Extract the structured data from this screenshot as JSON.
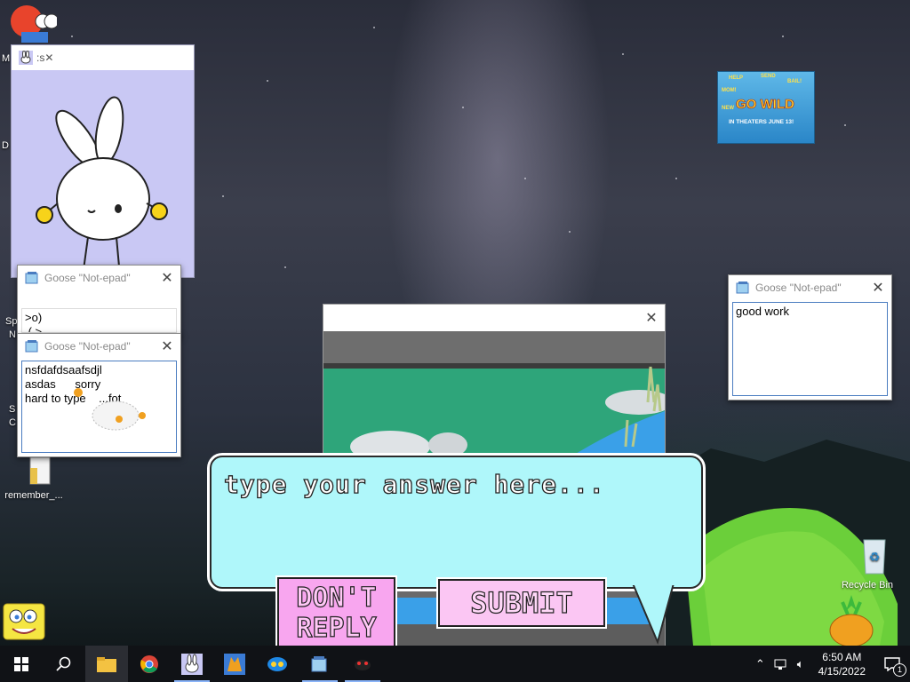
{
  "desktop": {
    "icons": [
      {
        "label": "M"
      },
      {
        "label": "D"
      },
      {
        "label": "Sp"
      },
      {
        "label": "N"
      },
      {
        "label": "S"
      },
      {
        "label": "C"
      },
      {
        "label": "remember_..."
      },
      {
        "label": "Recycle Bin"
      }
    ],
    "poster": {
      "words": [
        "HELP",
        "SEND",
        "MOM!",
        "BAIL!",
        "NEW",
        "GO WILD",
        "IN THEATERS JUNE 13!"
      ]
    }
  },
  "bunny_window": {
    "title": ":s"
  },
  "notepads": [
    {
      "title": "Goose \"Not-epad\"",
      "text": ">o)\n ( >"
    },
    {
      "title": "Goose \"Not-epad\"",
      "text": "nsfdafdsaafsdjl\nasdas      sorry\nhard to type    ...fot"
    },
    {
      "title": "Goose \"Not-epad\"",
      "text": "good work"
    }
  ],
  "dialog": {
    "prompt": "type your answer here...",
    "dont_reply": "DON'T\nREPLY",
    "submit": "SUBMIT"
  },
  "taskbar": {
    "time": "6:50 AM",
    "date": "4/15/2022",
    "notification_count": "1"
  },
  "colors": {
    "dialog_bg": "#aff7fa",
    "button_pink": "#f8a6ef",
    "bunny_bg": "#c9c8f4",
    "taskbar": "#101216"
  }
}
